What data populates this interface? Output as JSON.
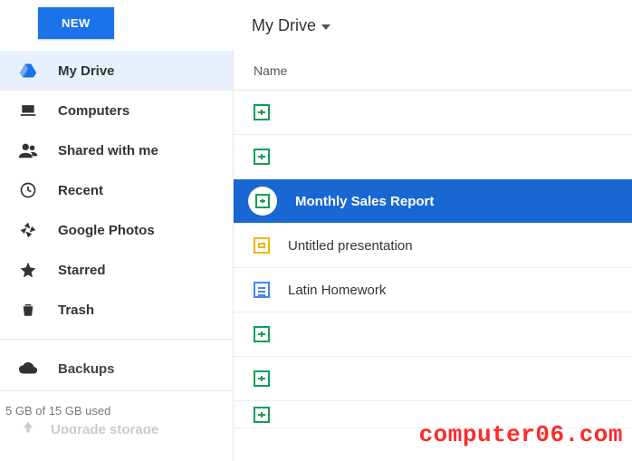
{
  "topbar": {
    "new_button": "NEW",
    "breadcrumb": "My Drive"
  },
  "sidebar": {
    "items": [
      {
        "id": "mydrive",
        "label": "My Drive",
        "icon": "drive-icon",
        "active": true
      },
      {
        "id": "computers",
        "label": "Computers",
        "icon": "laptop-icon",
        "active": false
      },
      {
        "id": "shared",
        "label": "Shared with me",
        "icon": "people-icon",
        "active": false
      },
      {
        "id": "recent",
        "label": "Recent",
        "icon": "clock-icon",
        "active": false
      },
      {
        "id": "photos",
        "label": "Google Photos",
        "icon": "pinwheel-icon",
        "active": false
      },
      {
        "id": "starred",
        "label": "Starred",
        "icon": "star-icon",
        "active": false
      },
      {
        "id": "trash",
        "label": "Trash",
        "icon": "trash-icon",
        "active": false
      }
    ],
    "backups_label": "Backups",
    "storage_text": "5 GB of 15 GB used",
    "upgrade_label": "Upgrade storage"
  },
  "main": {
    "column_header": "Name",
    "files": [
      {
        "name": "",
        "type": "sheets",
        "selected": false
      },
      {
        "name": "",
        "type": "sheets",
        "selected": false
      },
      {
        "name": "Monthly Sales Report",
        "type": "sheets",
        "selected": true
      },
      {
        "name": "Untitled presentation",
        "type": "slides",
        "selected": false
      },
      {
        "name": "Latin Homework",
        "type": "docs",
        "selected": false
      },
      {
        "name": "",
        "type": "sheets",
        "selected": false
      },
      {
        "name": "",
        "type": "sheets",
        "selected": false
      },
      {
        "name": "",
        "type": "sheets",
        "selected": false
      }
    ]
  },
  "watermark": "computer06.com"
}
